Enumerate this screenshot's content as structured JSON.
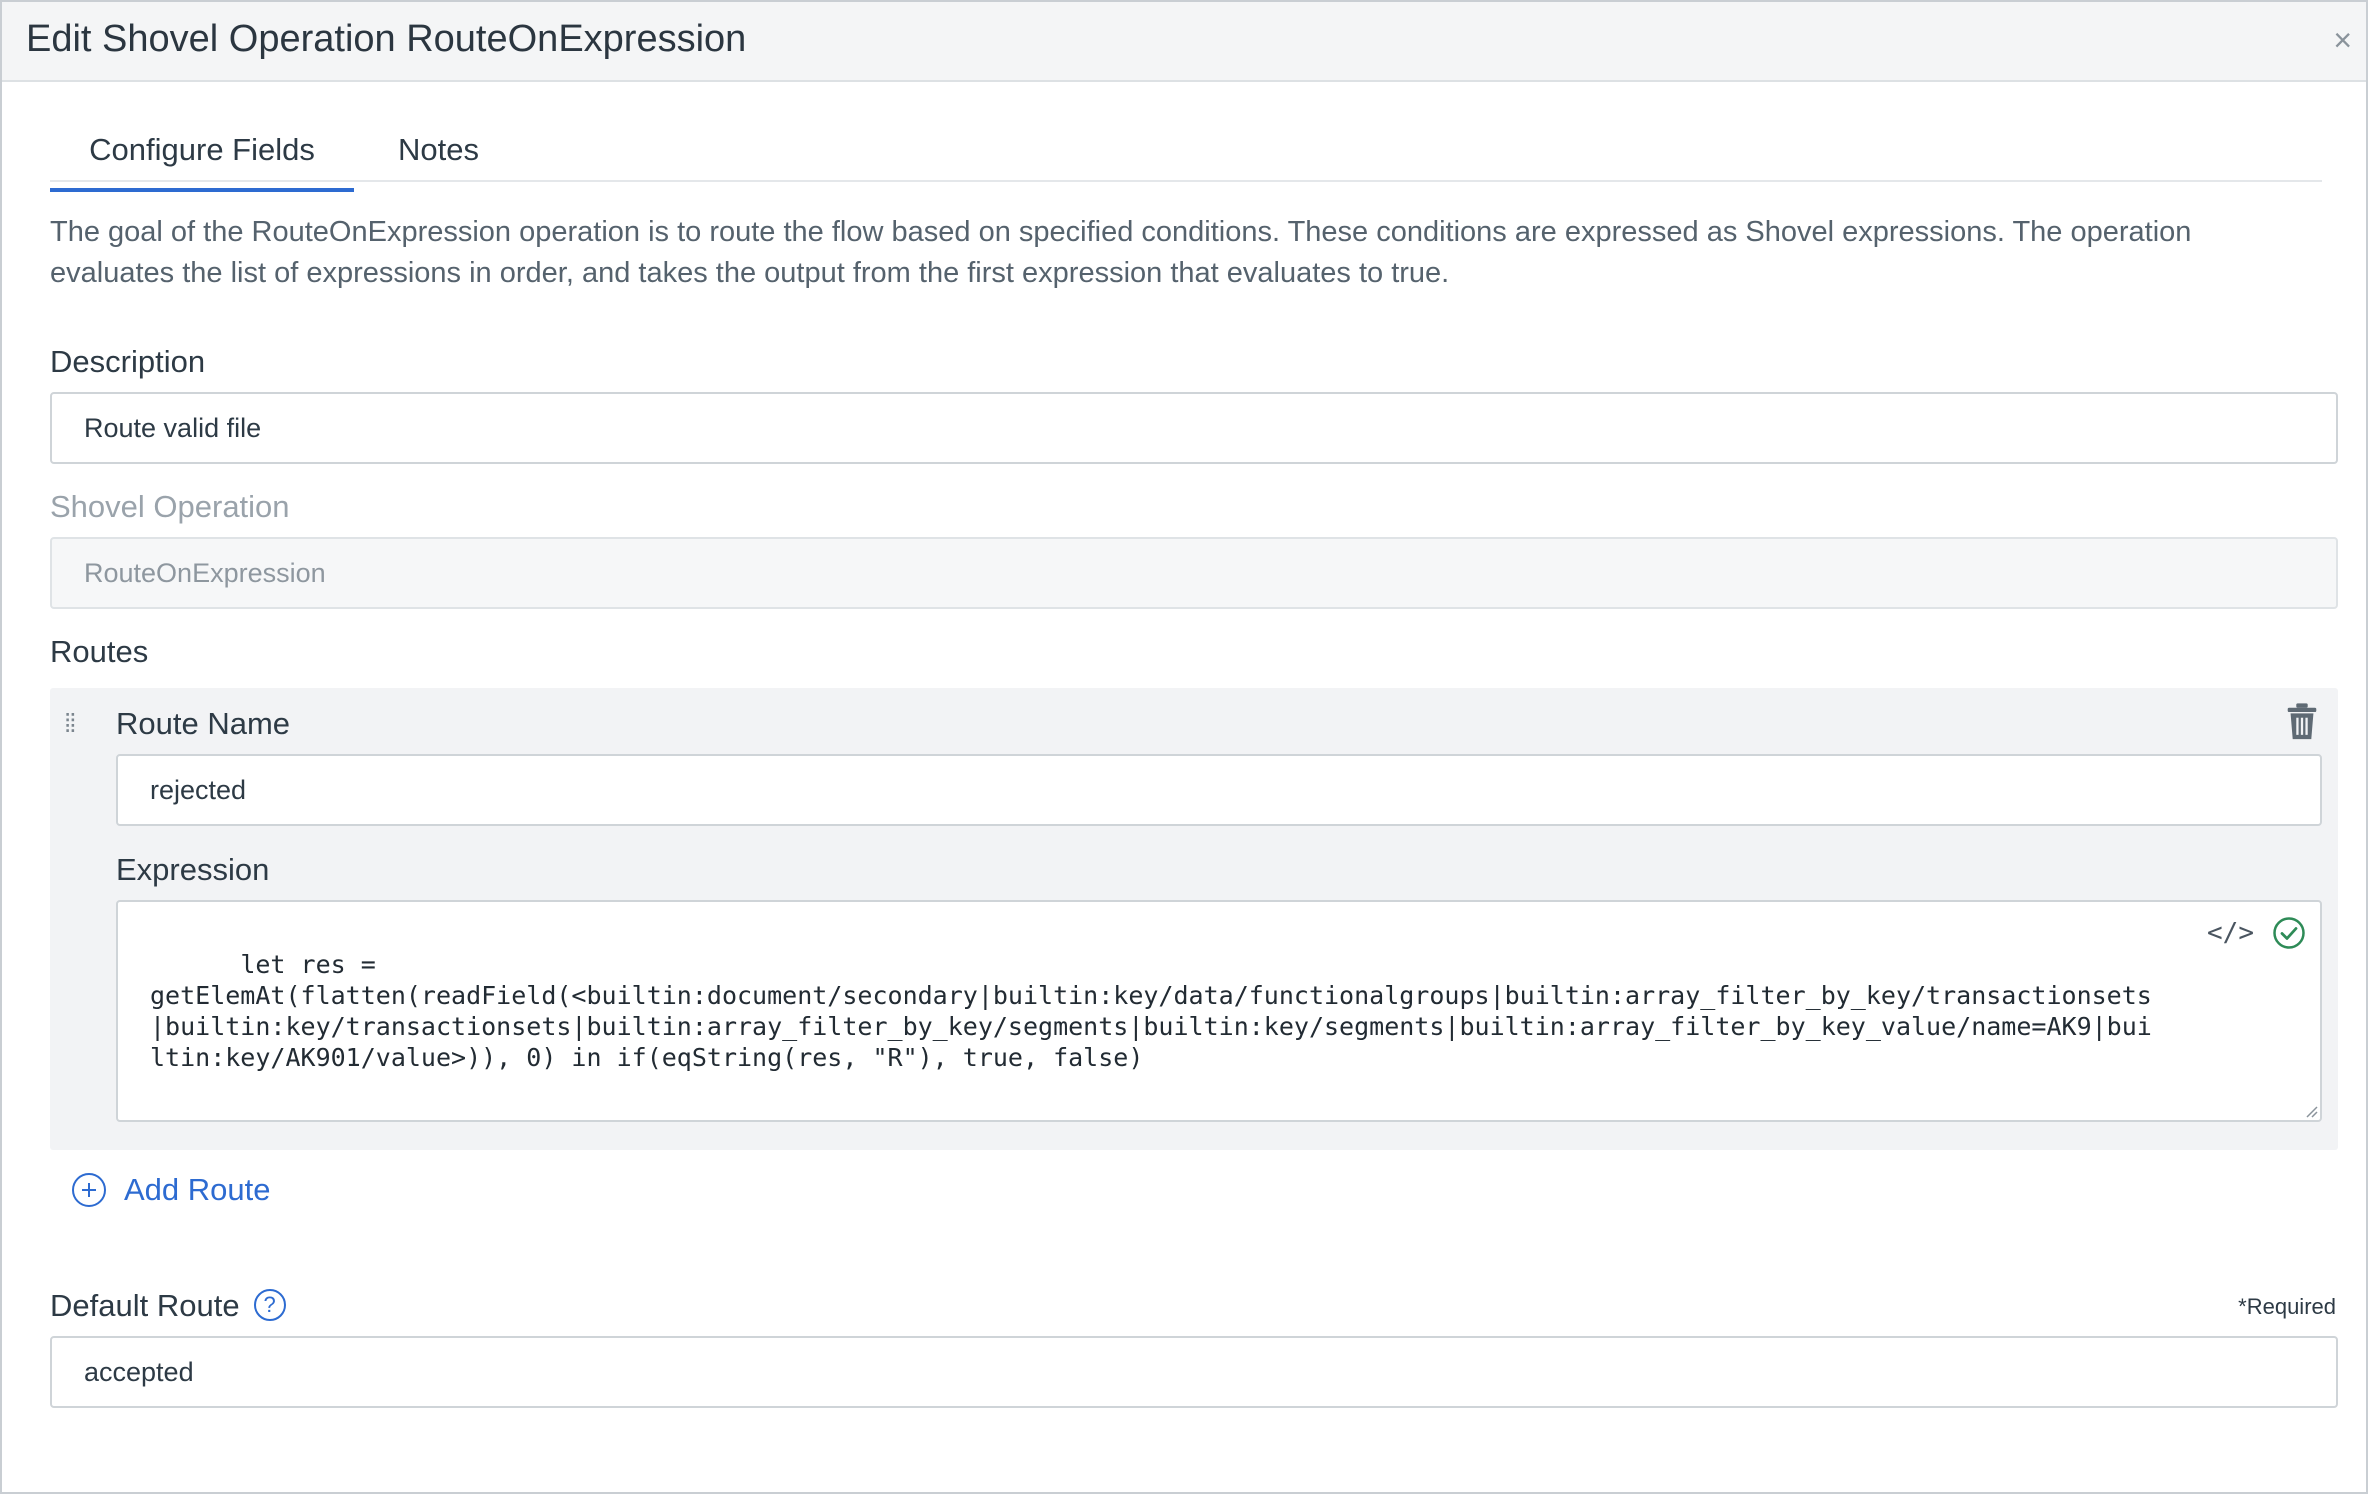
{
  "dialog": {
    "title": "Edit Shovel Operation RouteOnExpression",
    "close_glyph": "×"
  },
  "tabs": [
    {
      "label": "Configure Fields",
      "active": true
    },
    {
      "label": "Notes",
      "active": false
    }
  ],
  "intro": "The goal of the RouteOnExpression operation is to route the flow based on specified conditions. These conditions are expressed as Shovel expressions. The operation evaluates the list of expressions in order, and takes the output from the first expression that evaluates to true.",
  "fields": {
    "description_label": "Description",
    "description_value": "Route valid file",
    "operation_label": "Shovel Operation",
    "operation_value": "RouteOnExpression",
    "routes_label": "Routes"
  },
  "routes": [
    {
      "name_label": "Route Name",
      "name_value": "rejected",
      "expression_label": "Expression",
      "expression_value": "let res =\ngetElemAt(flatten(readField(<builtin:document/secondary|builtin:key/data/functionalgroups|builtin:array_filter_by_key/transactionsets\n|builtin:key/transactionsets|builtin:array_filter_by_key/segments|builtin:key/segments|builtin:array_filter_by_key_value/name=AK9|bui\nltin:key/AK901/value>)), 0) in if(eqString(res, \"R\"), true, false)"
    }
  ],
  "add_route_label": "Add Route",
  "default_route": {
    "label": "Default Route",
    "help_glyph": "?",
    "required_text": "*Required",
    "value": "accepted"
  },
  "icons": {
    "drag": "drag-handle-icon",
    "delete": "trash-icon",
    "code": "code-icon",
    "valid": "check-circle-icon",
    "add": "plus-circle-icon",
    "help": "question-circle-icon"
  },
  "colors": {
    "accent": "#2d6bd1",
    "valid": "#2e8b57",
    "header_bg": "#f4f5f6",
    "card_bg": "#f2f3f5"
  }
}
